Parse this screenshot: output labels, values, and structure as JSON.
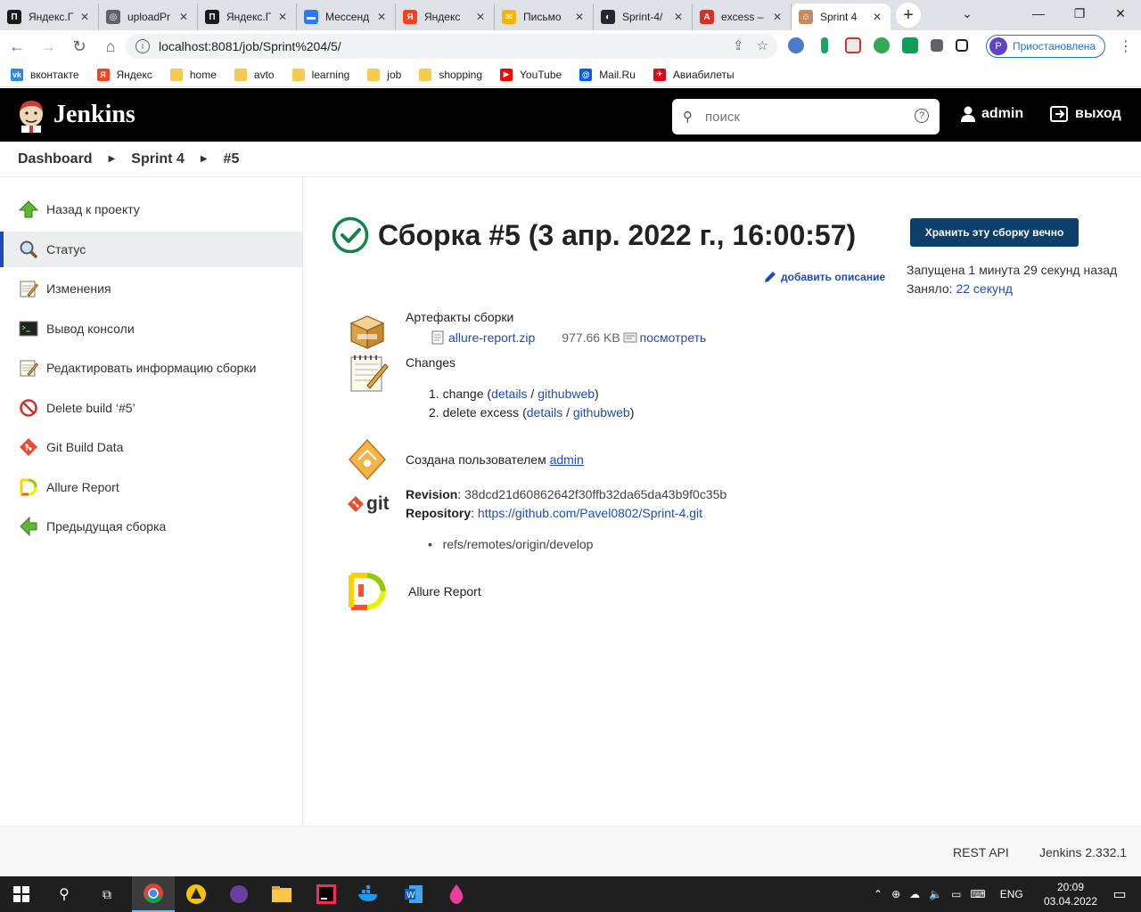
{
  "browser": {
    "tabs": [
      {
        "label": "Яндекс.Г",
        "color": "#1a1a1a",
        "glyph": "П"
      },
      {
        "label": "uploadPr",
        "color": "#5f6368",
        "glyph": "◎"
      },
      {
        "label": "Яндекс.Г",
        "color": "#1a1a1a",
        "glyph": "П"
      },
      {
        "label": "Мессенд",
        "color": "#2979ff",
        "glyph": "▬"
      },
      {
        "label": "Яндекс",
        "color": "#fc3f1d",
        "glyph": "Я"
      },
      {
        "label": "Письмо",
        "color": "#ffb300",
        "glyph": "✉"
      },
      {
        "label": "Sprint-4/",
        "color": "#24292f",
        "glyph": "◐"
      },
      {
        "label": "excess –",
        "color": "#d93025",
        "glyph": "A"
      },
      {
        "label": "Sprint 4",
        "color": "#c98a5d",
        "glyph": "☺"
      }
    ],
    "url": "localhost:8081/job/Sprint%204/5/",
    "profile_initial": "P",
    "profile_label": "Приостановлена",
    "bookmarks": [
      {
        "label": "вконтакте",
        "kind": "vk"
      },
      {
        "label": "Яндекс",
        "kind": "ya"
      },
      {
        "label": "home",
        "kind": "folder"
      },
      {
        "label": "avto",
        "kind": "folder"
      },
      {
        "label": "learning",
        "kind": "folder"
      },
      {
        "label": "job",
        "kind": "folder"
      },
      {
        "label": "shopping",
        "kind": "folder"
      },
      {
        "label": "YouTube",
        "kind": "yt"
      },
      {
        "label": "Mail.Ru",
        "kind": "mail"
      },
      {
        "label": "Авиабилеты",
        "kind": "avia"
      }
    ]
  },
  "jenkins": {
    "brand": "Jenkins",
    "search_placeholder": "поиск",
    "user": "admin",
    "logout": "выход"
  },
  "breadcrumb": [
    "Dashboard",
    "Sprint 4",
    "#5"
  ],
  "sidebar": [
    {
      "label": "Назад к проекту",
      "icon": "up-arrow-icon"
    },
    {
      "label": "Статус",
      "icon": "magnifier-icon",
      "active": true
    },
    {
      "label": "Изменения",
      "icon": "notepad-icon"
    },
    {
      "label": "Вывод консоли",
      "icon": "terminal-icon"
    },
    {
      "label": "Редактировать информацию сборки",
      "icon": "notepad-icon"
    },
    {
      "label": "Delete build ‘#5’",
      "icon": "no-entry-icon"
    },
    {
      "label": "Git Build Data",
      "icon": "git-icon"
    },
    {
      "label": "Allure Report",
      "icon": "allure-icon"
    },
    {
      "label": "Предыдущая сборка",
      "icon": "left-arrow-icon"
    }
  ],
  "build": {
    "title": "Сборка #5 (3 апр. 2022 г., 16:00:57)",
    "keep_button": "Хранить эту сборку вечно",
    "add_description": "добавить описание",
    "started_prefix": "Запущена",
    "started_value": "1 минута 29 секунд назад",
    "took_prefix": "Заняло:",
    "took_value": "22 секунд",
    "artifacts_title": "Артефакты сборки",
    "artifact_name": "allure-report.zip",
    "artifact_size": "977.66 KB",
    "artifact_view": "посмотреть",
    "changes_title": "Changes",
    "changes": [
      {
        "num": "1.",
        "text": "change",
        "details": "details",
        "web": "githubweb"
      },
      {
        "num": "2.",
        "text": "delete excess",
        "details": "details",
        "web": "githubweb"
      }
    ],
    "created_by_prefix": "Создана пользователем",
    "created_by_user": "admin",
    "revision_label": "Revision",
    "revision_value": "38dcd21d60862642f30ffb32da65da43b9f0c35b",
    "repository_label": "Repository",
    "repository_value": "https://github.com/Pavel0802/Sprint-4.git",
    "ref": "refs/remotes/origin/develop",
    "allure_link": "Allure Report"
  },
  "footer": {
    "rest_api": "REST API",
    "version": "Jenkins 2.332.1"
  },
  "taskbar": {
    "lang": "ENG",
    "time": "20:09",
    "date": "03.04.2022"
  }
}
